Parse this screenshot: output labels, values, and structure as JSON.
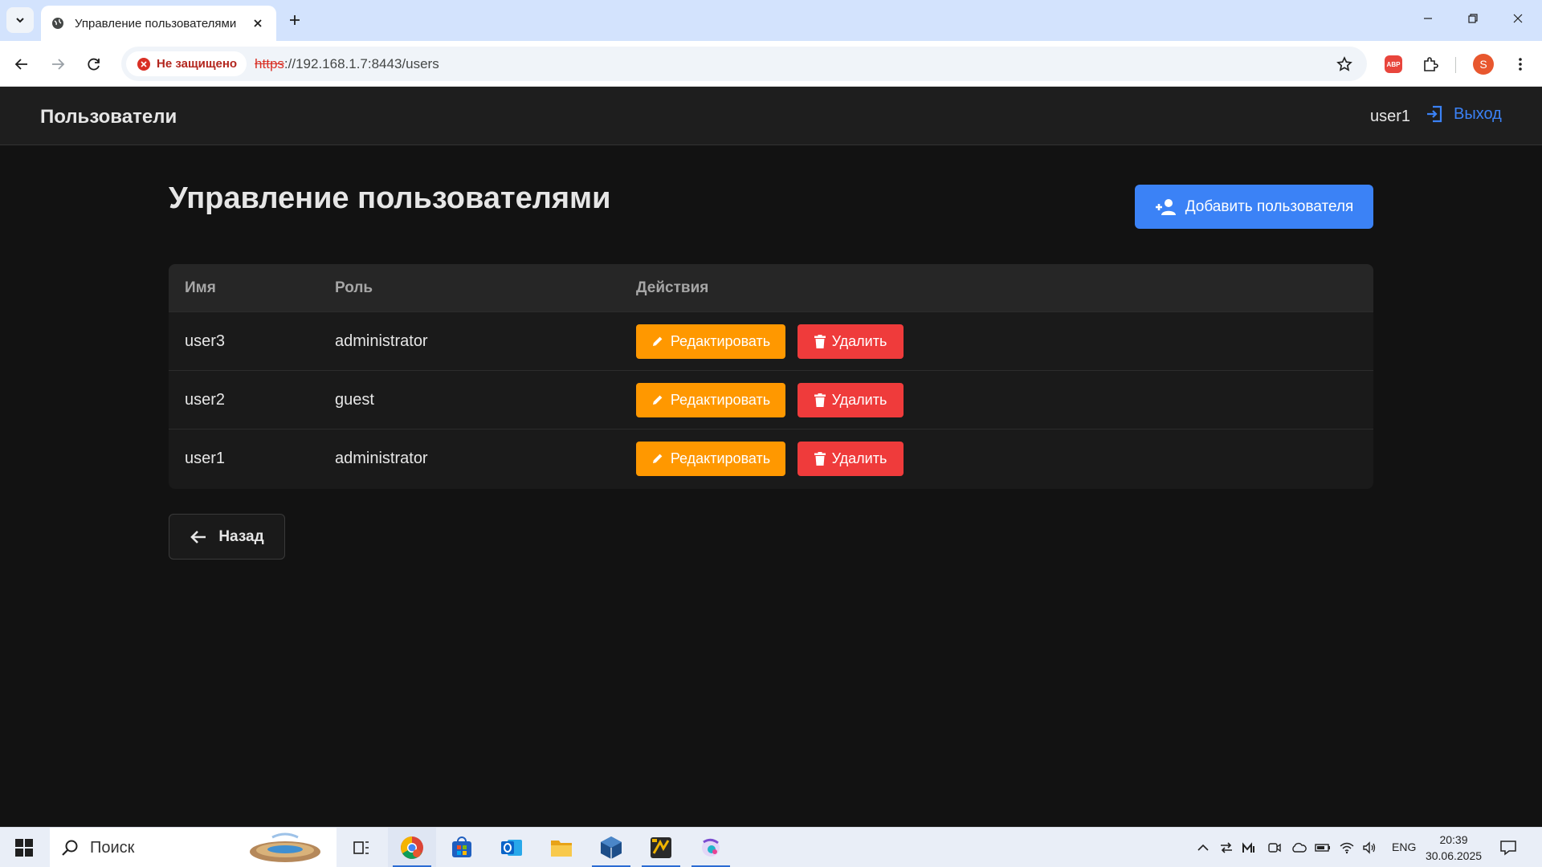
{
  "browser": {
    "tab_title": "Управление пользователями",
    "security_label": "Не защищено",
    "url_scheme": "https",
    "url_rest": "://192.168.1.7:8443/users",
    "profile_initial": "S",
    "extension_abp": "ABP"
  },
  "header": {
    "title": "Пользователи",
    "username": "user1",
    "logout_label": "Выход"
  },
  "main": {
    "page_title": "Управление пользователями",
    "add_user_label": "Добавить пользователя",
    "back_label": "Назад"
  },
  "table": {
    "columns": [
      "Имя",
      "Роль",
      "Действия"
    ],
    "rows": [
      {
        "name": "user3",
        "role": "administrator"
      },
      {
        "name": "user2",
        "role": "guest"
      },
      {
        "name": "user1",
        "role": "administrator"
      }
    ],
    "edit_label": "Редактировать",
    "delete_label": "Удалить"
  },
  "taskbar": {
    "search_placeholder": "Поиск",
    "language": "ENG",
    "time": "20:39",
    "date": "30.06.2025"
  },
  "colors": {
    "accent": "#3b82f6",
    "edit": "#ff9800",
    "delete": "#ef3b3b",
    "background": "#121212",
    "header": "#1e1e1e"
  }
}
